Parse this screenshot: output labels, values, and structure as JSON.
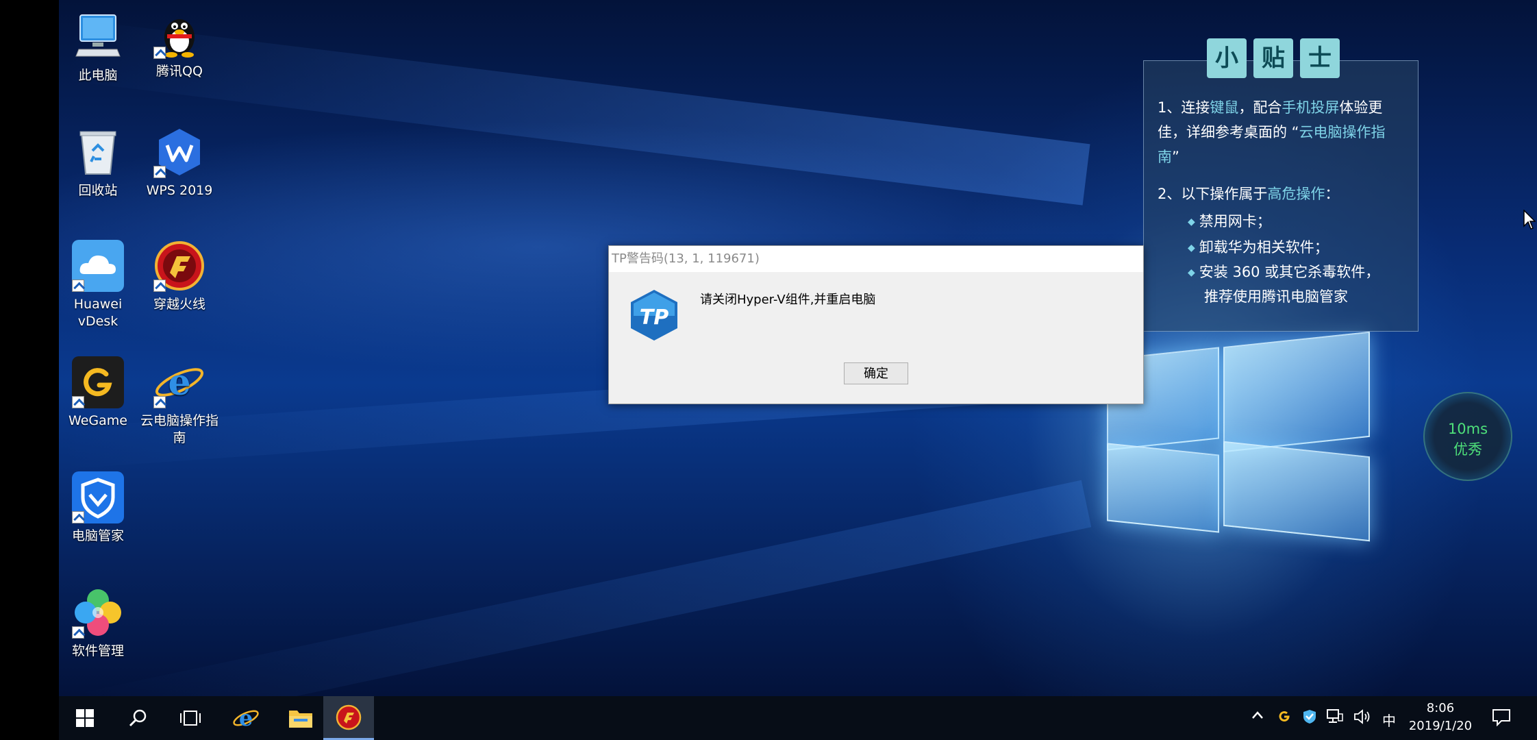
{
  "desktop_icons": [
    {
      "label": "此电脑",
      "icon": "computer-icon"
    },
    {
      "label": "腾讯QQ",
      "icon": "qq-penguin-icon"
    },
    {
      "label": "回收站",
      "icon": "recycle-bin-icon"
    },
    {
      "label": "WPS 2019",
      "icon": "wps-icon"
    },
    {
      "label": "Huawei vDesk",
      "icon": "cloud-icon"
    },
    {
      "label": "穿越火线",
      "icon": "crossfire-icon"
    },
    {
      "label": "WeGame",
      "icon": "wegame-icon"
    },
    {
      "label": "云电脑操作指南",
      "icon": "ie-icon"
    },
    {
      "label": "电脑管家",
      "icon": "shield-icon"
    },
    {
      "label": "软件管理",
      "icon": "clover-icon"
    }
  ],
  "tips": {
    "title_chars": [
      "小",
      "贴",
      "士"
    ],
    "tip1_a": "1、连接",
    "tip1_hl1": "键鼠",
    "tip1_b": "，配合",
    "tip1_hl2": "手机投屏",
    "tip1_c": "体验更佳，详细参考桌面的 “",
    "tip1_hl3": "云电脑操作指南",
    "tip1_d": "”",
    "tip2_a": "2、以下操作属于",
    "tip2_hl": "高危操作",
    "tip2_b": "：",
    "bullets": [
      "禁用网卡；",
      "卸载华为相关软件；",
      "安装 360 或其它杀毒软件，",
      "推荐使用腾讯电脑管家"
    ]
  },
  "dialog": {
    "title": "TP警告码(13, 1, 119671)",
    "message": "请关闭Hyper-V组件,并重启电脑",
    "ok_label": "确定"
  },
  "ping": {
    "value": "10ms",
    "quality": "优秀"
  },
  "taskbar": {
    "time": "8:06",
    "date": "2019/1/20",
    "ime": "中",
    "apps": [
      "start-icon",
      "search-icon",
      "task-view-icon",
      "ie-icon",
      "file-explorer-icon",
      "crossfire-icon"
    ]
  },
  "colors": {
    "tip_highlight": "#7fd4e8",
    "ping_green": "#4ee07a",
    "taskbar": "#070d17"
  }
}
